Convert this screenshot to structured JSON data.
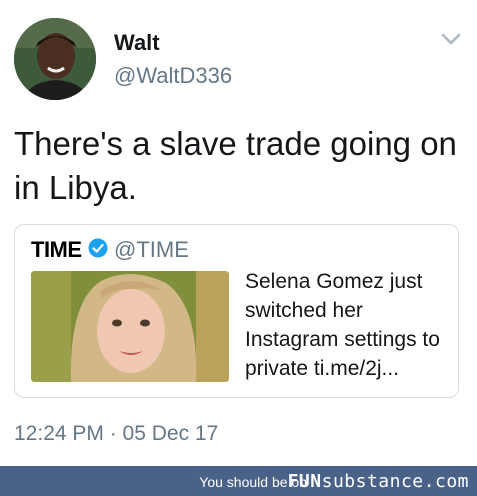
{
  "user": {
    "name": "Walt",
    "handle": "@WaltD336"
  },
  "tweet": {
    "text": "There's a slave trade going on in Libya."
  },
  "quoted": {
    "brand": "TIME",
    "handle": "@TIME",
    "text": "Selena Gomez just switched her Instagram settings to private ti.me/2j..."
  },
  "timestamp": "12:24 PM · 05 Dec 17",
  "footer": {
    "prefix": "You should be on",
    "brand_bold": "FUN",
    "brand_rest": "substance.com"
  },
  "colors": {
    "verified": "#1da1f2",
    "footer_bg": "#4a6288",
    "muted": "#657786"
  },
  "icons": {
    "menu": "chevron-down-icon",
    "verified": "verified-badge-icon"
  }
}
